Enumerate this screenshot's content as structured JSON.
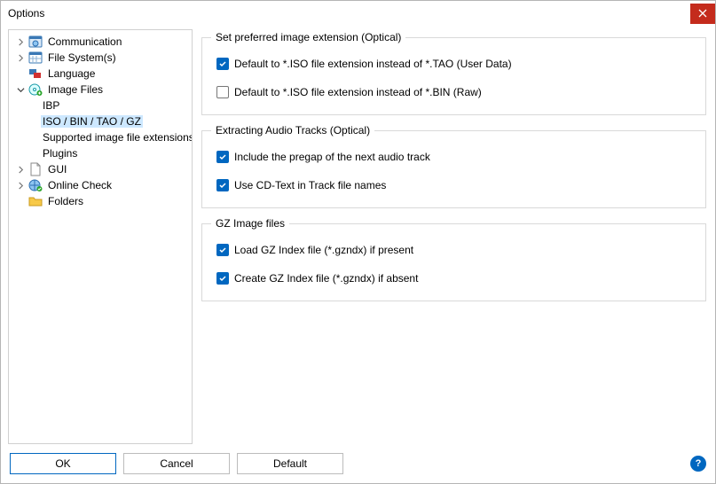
{
  "window": {
    "title": "Options"
  },
  "tree": {
    "items": [
      {
        "label": "Communication",
        "expandable": true,
        "expanded": false,
        "icon": "globe-window"
      },
      {
        "label": "File System(s)",
        "expandable": true,
        "expanded": false,
        "icon": "calendar"
      },
      {
        "label": "Language",
        "expandable": false,
        "icon": "flags"
      },
      {
        "label": "Image Files",
        "expandable": true,
        "expanded": true,
        "icon": "disc-add"
      },
      {
        "label": "IBP",
        "depth": 1
      },
      {
        "label": "ISO / BIN / TAO / GZ",
        "depth": 1,
        "selected": true
      },
      {
        "label": "Supported image file extensions",
        "depth": 1
      },
      {
        "label": "Plugins",
        "depth": 1
      },
      {
        "label": "GUI",
        "expandable": true,
        "expanded": false,
        "icon": "blank-doc"
      },
      {
        "label": "Online Check",
        "expandable": true,
        "expanded": false,
        "icon": "globe-check"
      },
      {
        "label": "Folders",
        "expandable": false,
        "icon": "folder"
      }
    ]
  },
  "groups": {
    "preferred": {
      "legend": "Set preferred image extension (Optical)",
      "opt_tao": "Default to *.ISO file extension instead of *.TAO (User Data)",
      "opt_bin": "Default to *.ISO file extension instead of *.BIN (Raw)"
    },
    "audio": {
      "legend": "Extracting Audio Tracks (Optical)",
      "opt_pregap": "Include the pregap of the next audio track",
      "opt_cdtext": "Use CD-Text in Track file names"
    },
    "gz": {
      "legend": "GZ Image files",
      "opt_load": "Load GZ Index file (*.gzndx) if present",
      "opt_create": "Create GZ Index file (*.gzndx) if absent"
    }
  },
  "checks": {
    "tao": true,
    "bin": false,
    "pregap": true,
    "cdtext": true,
    "gzload": true,
    "gzcreate": true
  },
  "footer": {
    "ok": "OK",
    "cancel": "Cancel",
    "default": "Default",
    "help": "?"
  }
}
